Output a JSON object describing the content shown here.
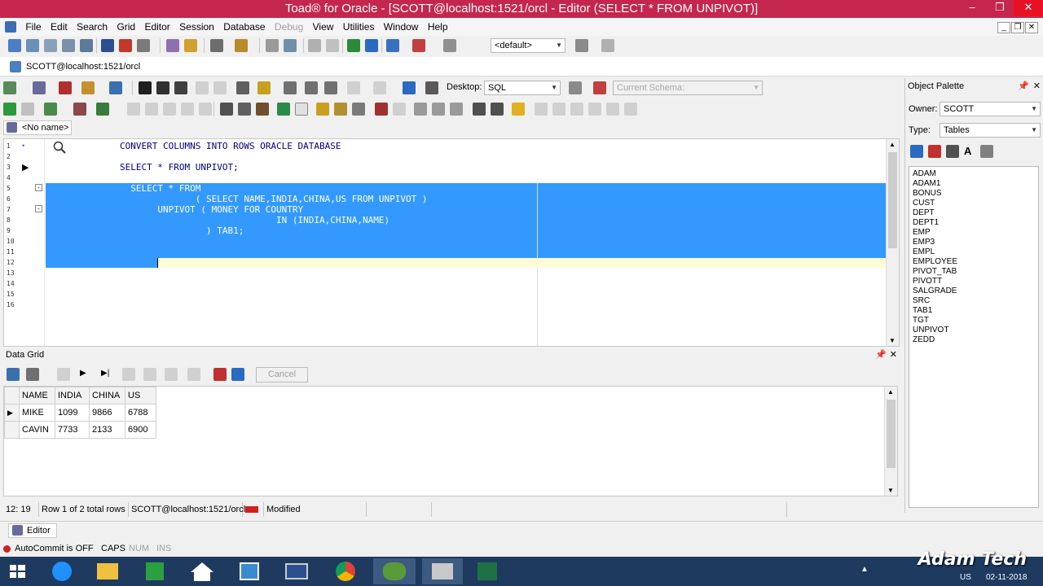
{
  "window": {
    "title": "Toad® for Oracle - [SCOTT@localhost:1521/orcl - Editor (SELECT * FROM UNPIVOT)]"
  },
  "menu": [
    "File",
    "Edit",
    "Search",
    "Grid",
    "Editor",
    "Session",
    "Database",
    "Debug",
    "View",
    "Utilities",
    "Window",
    "Help"
  ],
  "toolbar": {
    "profile_combo": "<default>",
    "desktop_label": "Desktop:",
    "desktop_value": "SQL",
    "schema_placeholder": "Current Schema:"
  },
  "connection_tab": {
    "label": "SCOTT@localhost:1521/orcl"
  },
  "editor_tab": {
    "label": "<No name>"
  },
  "editor": {
    "line_numbers": [
      "1",
      "2",
      "3",
      "4",
      "5",
      "6",
      "7",
      "8",
      "9",
      "10",
      "11",
      "12",
      "13",
      "14",
      "15",
      "16"
    ],
    "lines": [
      "CONVERT COLUMNS INTO ROWS ORACLE DATABASE",
      "",
      "SELECT * FROM UNPIVOT;",
      "",
      "  SELECT * FROM",
      "              ( SELECT NAME,INDIA,CHINA,US FROM UNPIVOT )",
      "       UNPIVOT ( MONEY FOR COUNTRY",
      "                             IN (INDIA,CHINA,NAME)",
      "                ) TAB1;",
      "",
      "",
      ""
    ]
  },
  "data_grid": {
    "title": "Data Grid",
    "cancel_label": "Cancel",
    "columns": [
      "NAME",
      "INDIA",
      "CHINA",
      "US"
    ],
    "rows": [
      [
        "MIKE",
        "1099",
        "9866",
        "6788"
      ],
      [
        "CAVIN",
        "7733",
        "2133",
        "6900"
      ]
    ]
  },
  "status": {
    "position": "12: 19",
    "rows": "Row 1 of 2 total rows",
    "connection": "SCOTT@localhost:1521/orcl",
    "state": "Modified"
  },
  "bottom_tab": {
    "label": "Editor"
  },
  "app_status": {
    "autocommit": "AutoCommit is OFF",
    "caps": "CAPS",
    "num": "NUM",
    "ins": "INS"
  },
  "palette": {
    "title": "Object Palette",
    "owner_label": "Owner:",
    "owner_value": "SCOTT",
    "type_label": "Type:",
    "type_value": "Tables",
    "objects": [
      "ADAM",
      "ADAM1",
      "BONUS",
      "CUST",
      "DEPT",
      "DEPT1",
      "EMP",
      "EMP3",
      "EMPL",
      "EMPLOYEE",
      "PIVOT_TAB",
      "PIVOTT",
      "SALGRADE",
      "SRC",
      "TAB1",
      "TGT",
      "UNPIVOT",
      "ZEDD"
    ]
  },
  "taskbar": {
    "lang": "US",
    "date": "02-11-2018"
  },
  "watermark": "Adam Tech"
}
